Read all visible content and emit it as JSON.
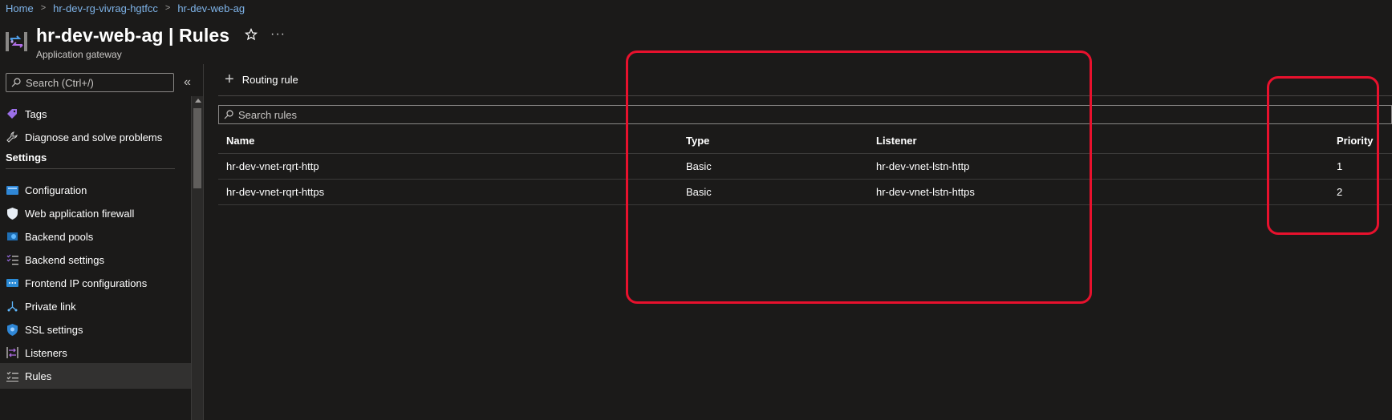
{
  "breadcrumb": {
    "items": [
      "Home",
      "hr-dev-rg-vivrag-hgtfcc",
      "hr-dev-web-ag"
    ]
  },
  "header": {
    "title": "hr-dev-web-ag | Rules",
    "subtitle": "Application gateway",
    "more": "···"
  },
  "sidebar": {
    "search_placeholder": "Search (Ctrl+/)",
    "collapse_glyph": "«",
    "items_top": [
      {
        "label": "Tags",
        "icon": "tag-icon"
      },
      {
        "label": "Diagnose and solve problems",
        "icon": "wrench-icon"
      }
    ],
    "section_label": "Settings",
    "settings_items": [
      {
        "label": "Configuration",
        "icon": "configuration-icon"
      },
      {
        "label": "Web application firewall",
        "icon": "shield-icon"
      },
      {
        "label": "Backend pools",
        "icon": "backend-pools-icon"
      },
      {
        "label": "Backend settings",
        "icon": "list-settings-icon"
      },
      {
        "label": "Frontend IP configurations",
        "icon": "frontend-ip-icon"
      },
      {
        "label": "Private link",
        "icon": "private-link-icon"
      },
      {
        "label": "SSL settings",
        "icon": "ssl-shield-icon"
      },
      {
        "label": "Listeners",
        "icon": "listeners-icon"
      },
      {
        "label": "Rules",
        "icon": "rules-icon",
        "active": true
      }
    ]
  },
  "toolbar": {
    "add_label": "Routing rule"
  },
  "search": {
    "placeholder": "Search rules"
  },
  "table": {
    "columns": [
      "Name",
      "Type",
      "Listener",
      "Priority"
    ],
    "rows": [
      {
        "name": "hr-dev-vnet-rqrt-http",
        "type": "Basic",
        "listener": "hr-dev-vnet-lstn-http",
        "priority": "1"
      },
      {
        "name": "hr-dev-vnet-rqrt-https",
        "type": "Basic",
        "listener": "hr-dev-vnet-lstn-https",
        "priority": "2"
      }
    ]
  },
  "colors": {
    "background": "#1b1a19",
    "link": "#7eb3e8",
    "highlight": "#e8112d",
    "active_item": "#323130"
  }
}
